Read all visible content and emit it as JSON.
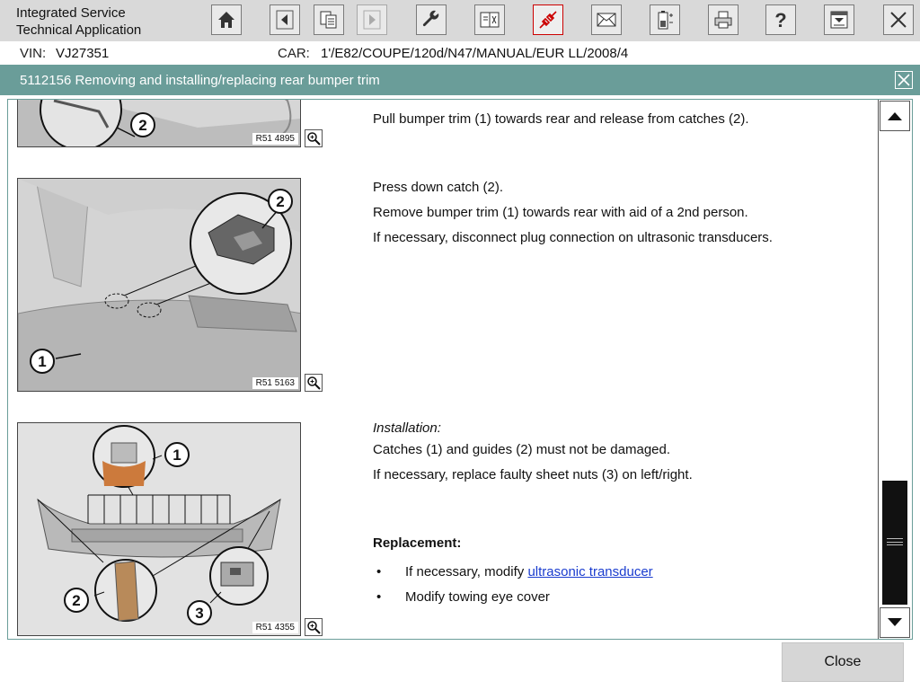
{
  "app": {
    "title_line1": "Integrated Service",
    "title_line2": "Technical Application"
  },
  "toolbar": {
    "buttons": [
      {
        "name": "home-button",
        "icon": "home-icon"
      },
      {
        "name": "back-button",
        "icon": "arrow-left-icon"
      },
      {
        "name": "documents-button",
        "icon": "documents-icon"
      },
      {
        "name": "forward-button",
        "icon": "arrow-right-icon",
        "state": "disabled"
      },
      {
        "name": "service-functions-button",
        "icon": "wrench-icon"
      },
      {
        "name": "comparison-button",
        "icon": "compare-icon"
      },
      {
        "name": "vehicle-connection-button",
        "icon": "plug-icon",
        "state": "active"
      },
      {
        "name": "messages-button",
        "icon": "envelope-icon"
      },
      {
        "name": "battery-button",
        "icon": "battery-icon"
      },
      {
        "name": "print-button",
        "icon": "printer-icon"
      },
      {
        "name": "help-button",
        "icon": "question-icon"
      },
      {
        "name": "minimize-button",
        "icon": "minimize-icon"
      },
      {
        "name": "exit-button",
        "icon": "close-icon"
      }
    ],
    "active_color": "#cc0000"
  },
  "vehicle": {
    "vin_label": "VIN:",
    "vin": "VJ27351",
    "car_label": "CAR:",
    "car": "1'/E82/COUPE/120d/N47/MANUAL/EUR LL/2008/4"
  },
  "document": {
    "title": "5112156 Removing and installing/replacing rear bumper trim",
    "header_color": "#6a9d99"
  },
  "steps": [
    {
      "figure_code": "R51 4895",
      "callouts": [
        "2"
      ],
      "lines": [
        "Pull bumper trim (1) towards rear and release from catches (2)."
      ]
    },
    {
      "figure_code": "R51 5163",
      "callouts": [
        "1",
        "2"
      ],
      "lines": [
        "Press down catch (2).",
        "Remove bumper trim (1) towards rear with aid of a 2nd person.",
        "If necessary, disconnect plug connection on ultrasonic transducers."
      ]
    },
    {
      "figure_code": "R51 4355",
      "callouts": [
        "1",
        "2",
        "3"
      ],
      "installation_heading": "Installation:",
      "lines": [
        "Catches (1) and guides (2) must not be damaged.",
        "If necessary, replace faulty sheet nuts (3) on left/right."
      ],
      "replacement_heading": "Replacement:",
      "bullets": [
        {
          "prefix": "If necessary, modify ",
          "link": "ultrasonic transducer"
        },
        {
          "prefix": "Modify towing eye cover",
          "link": ""
        }
      ]
    }
  ],
  "scroll": {
    "position_fraction": 0.82
  },
  "footer": {
    "close_label": "Close"
  }
}
